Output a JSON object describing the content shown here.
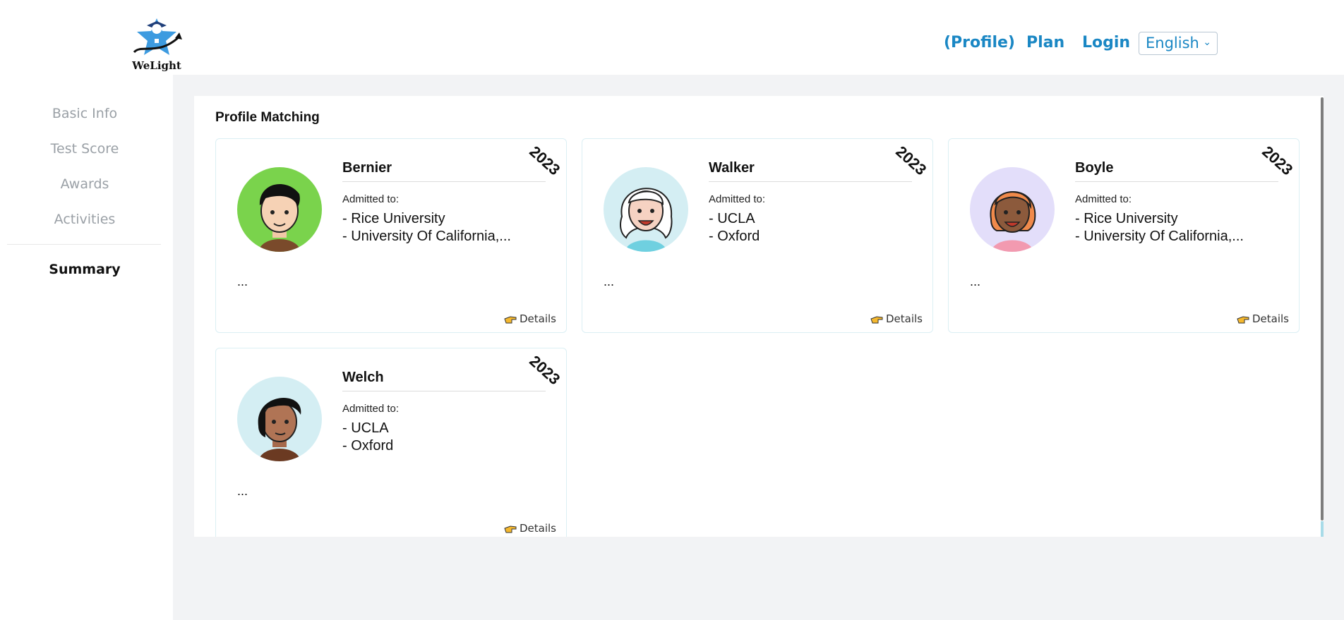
{
  "header": {
    "logo_text": "WeLight",
    "nav": [
      "(Profile)",
      "Plan",
      "Login"
    ],
    "language": "English"
  },
  "sidebar": {
    "items": [
      "Basic Info",
      "Test Score",
      "Awards",
      "Activities"
    ],
    "summary": "Summary"
  },
  "panel": {
    "title": "Profile Matching",
    "cards": [
      {
        "name": "Bernier",
        "year": "2023",
        "admitted_label": "Admitted to:",
        "schools": [
          "- Rice University",
          "- University Of California,..."
        ],
        "ellipsis": "...",
        "details": "Details",
        "avatar_bg": "#7ad34c"
      },
      {
        "name": "Walker",
        "year": "2023",
        "admitted_label": "Admitted to:",
        "schools": [
          "- UCLA",
          "- Oxford"
        ],
        "ellipsis": "...",
        "details": "Details",
        "avatar_bg": "#d4eef3"
      },
      {
        "name": "Boyle",
        "year": "2023",
        "admitted_label": "Admitted to:",
        "schools": [
          "- Rice University",
          "- University Of California,..."
        ],
        "ellipsis": "...",
        "details": "Details",
        "avatar_bg": "#e3defa"
      },
      {
        "name": "Welch",
        "year": "2023",
        "admitted_label": "Admitted to:",
        "schools": [
          "- UCLA",
          "- Oxford"
        ],
        "ellipsis": "...",
        "details": "Details",
        "avatar_bg": "#d4eef3"
      }
    ]
  },
  "colors": {
    "accent": "#1a87c4",
    "main_bg": "#f2f3f5"
  }
}
